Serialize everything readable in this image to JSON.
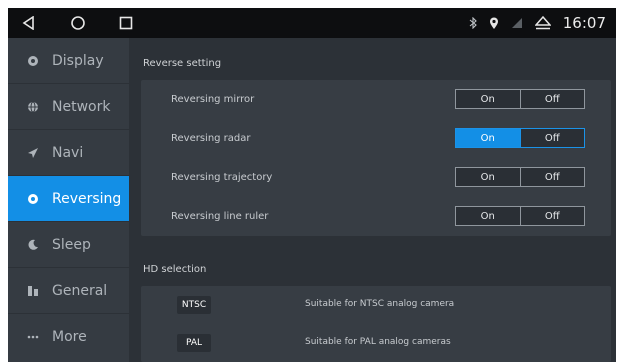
{
  "status_bar": {
    "nav_buttons": [
      "back-icon",
      "home-icon",
      "recents-icon"
    ],
    "status_icons": [
      "bluetooth-icon",
      "location-icon",
      "signal-icon",
      "eject-icon"
    ],
    "time": "16:07"
  },
  "sidebar": {
    "items": [
      {
        "label": "Display",
        "icon": "display-icon",
        "active": false
      },
      {
        "label": "Network",
        "icon": "globe-icon",
        "active": false
      },
      {
        "label": "Navi",
        "icon": "navigation-icon",
        "active": false
      },
      {
        "label": "Reversing",
        "icon": "reversing-icon",
        "active": true
      },
      {
        "label": "Sleep",
        "icon": "moon-icon",
        "active": false
      },
      {
        "label": "General",
        "icon": "general-icon",
        "active": false
      },
      {
        "label": "More",
        "icon": "more-icon",
        "active": false
      }
    ]
  },
  "reverse": {
    "title": "Reverse setting",
    "rows": [
      {
        "label": "Reversing mirror",
        "on": "On",
        "off": "Off",
        "selected": "off"
      },
      {
        "label": "Reversing radar",
        "on": "On",
        "off": "Off",
        "selected": "on"
      },
      {
        "label": "Reversing trajectory",
        "on": "On",
        "off": "Off",
        "selected": "off"
      },
      {
        "label": "Reversing line ruler",
        "on": "On",
        "off": "Off",
        "selected": "off"
      }
    ]
  },
  "hd": {
    "title": "HD selection",
    "options": [
      {
        "badge": "NTSC",
        "desc": "Suitable for NTSC analog camera"
      },
      {
        "badge": "PAL",
        "desc": "Suitable for PAL analog cameras"
      }
    ]
  },
  "colors": {
    "accent": "#138fe6",
    "status_bar": "#0d0e10",
    "sidebar": "#353b42",
    "content": "#2c3137",
    "panel": "#373d44"
  }
}
